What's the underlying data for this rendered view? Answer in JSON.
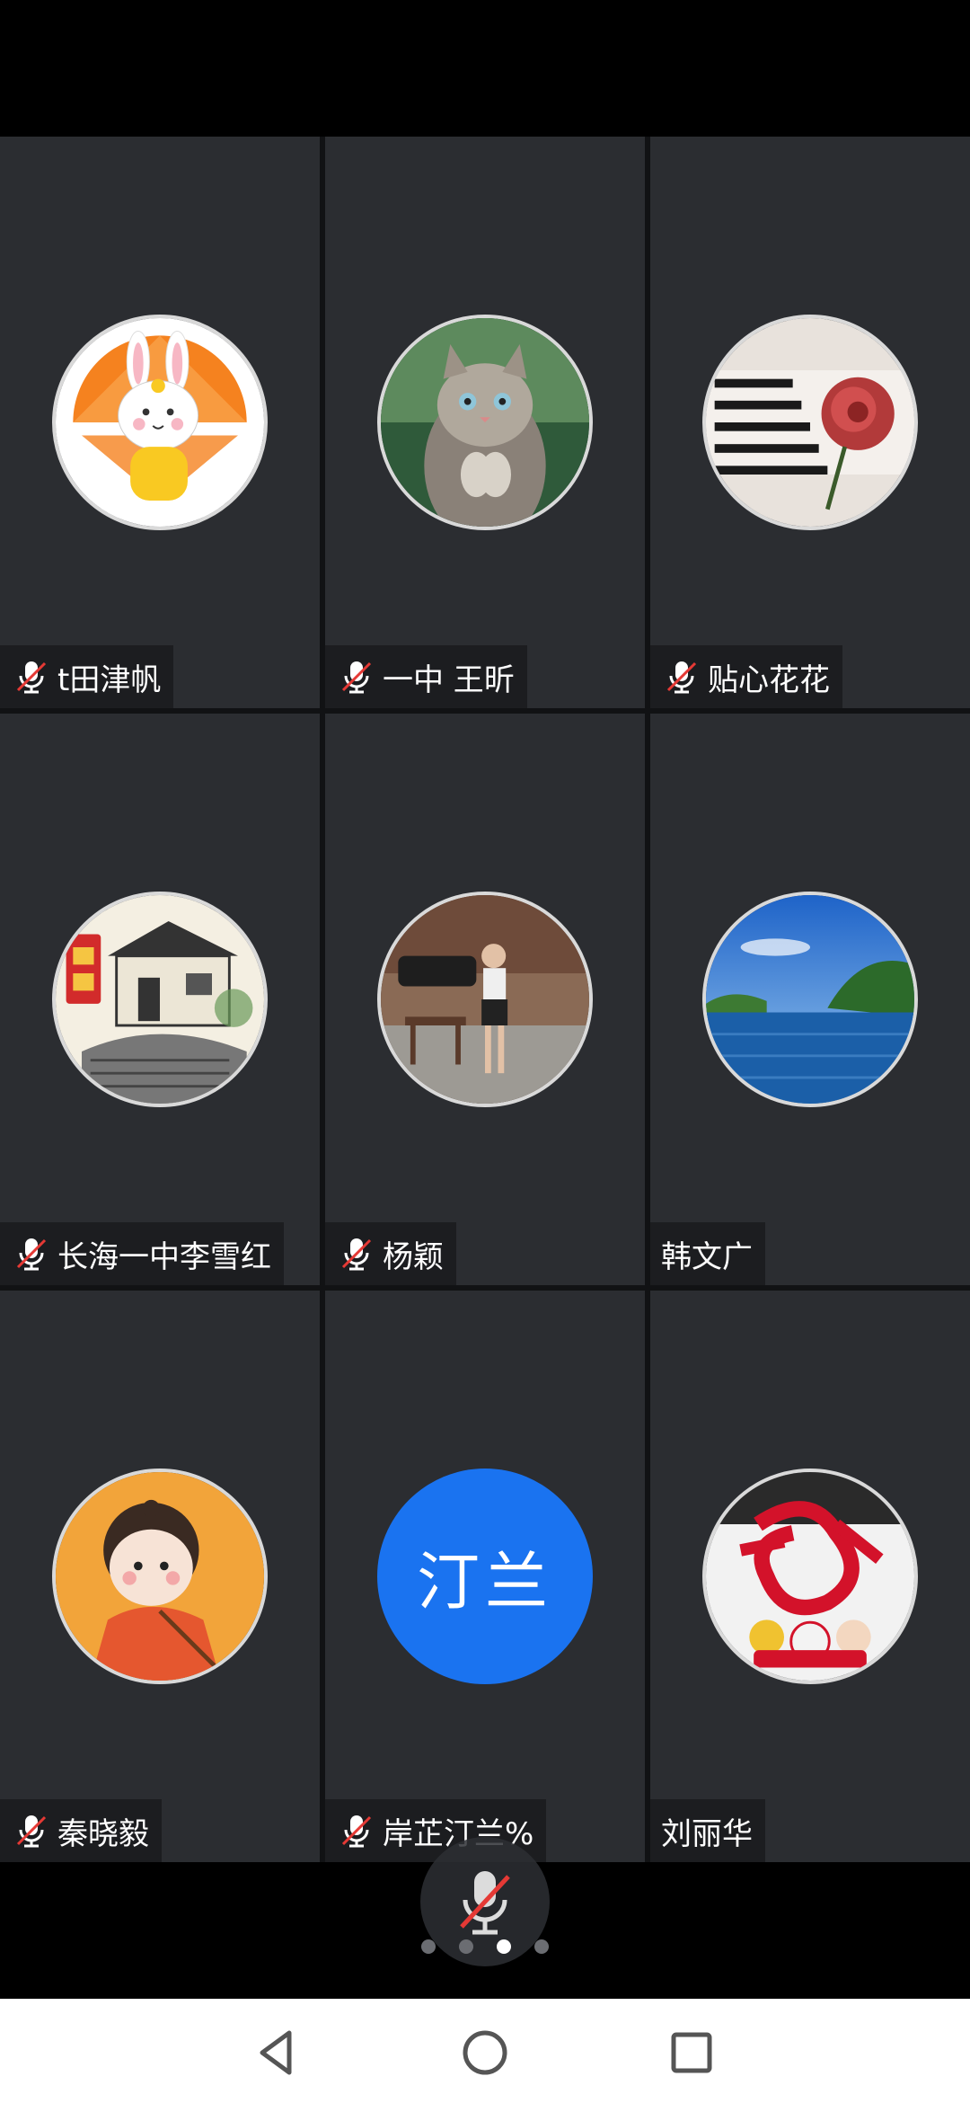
{
  "participants": [
    {
      "name": "t田津帆",
      "muted": true,
      "avatar": "rabbit-umbrella"
    },
    {
      "name": "一中  王昕",
      "muted": true,
      "avatar": "kitten"
    },
    {
      "name": "贴心花花",
      "muted": true,
      "avatar": "piano-rose"
    },
    {
      "name": "长海一中李雪红",
      "muted": true,
      "avatar": "good-luck-painting"
    },
    {
      "name": "杨颖",
      "muted": true,
      "avatar": "woman-street"
    },
    {
      "name": "韩文广",
      "muted": false,
      "avatar": "lake-island"
    },
    {
      "name": "秦晓毅",
      "muted": true,
      "avatar": "cartoon-girl"
    },
    {
      "name": "岸芷汀兰%",
      "muted": true,
      "avatar": "text",
      "initials": "汀兰"
    },
    {
      "name": "刘丽华",
      "muted": false,
      "avatar": "fu-character"
    }
  ],
  "pagination": {
    "pages": 4,
    "current": 3
  },
  "colors": {
    "tile_bg": "#2b2d31",
    "label_bg": "#1c1d20",
    "text_avatar_bg": "#1a73f0",
    "mute_slash": "#e53935"
  },
  "controls": {
    "mic_button": "muted-microphone-icon"
  },
  "nav": {
    "back": "back-triangle-icon",
    "home": "home-circle-icon",
    "recents": "recents-square-icon"
  }
}
